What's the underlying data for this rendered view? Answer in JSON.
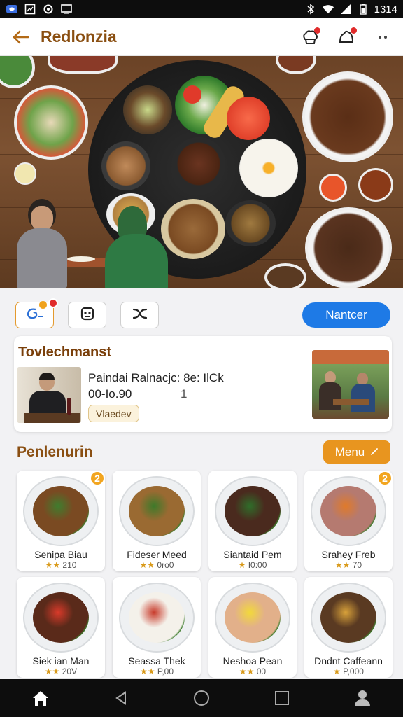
{
  "status_bar": {
    "time": "1314"
  },
  "app_bar": {
    "title": "Redlonzia"
  },
  "filters": {
    "primary_label": "Nantcer"
  },
  "info_card": {
    "title": "Tovlechmanst",
    "line1": "Paindai Ralnacjc: 8e: IlCk",
    "line2": "00-Io.90",
    "number": "1",
    "tag": "Vlaedev"
  },
  "section": {
    "title": "Penlenurin",
    "menu_label": "Menu"
  },
  "foods": [
    {
      "name": "Senipa Biau",
      "rating": "210",
      "stars": "★★",
      "badge": "2",
      "plate": "#7a4a22",
      "accent": "#3f7d2e"
    },
    {
      "name": "Fideser Meed",
      "rating": "0ro0",
      "stars": "★★",
      "badge": "",
      "plate": "#9a6a32",
      "accent": "#3d7a2a"
    },
    {
      "name": "Siantaid Pem",
      "rating": "I0:00",
      "stars": "★",
      "badge": "",
      "plate": "#4a2a1e",
      "accent": "#2f6e2a"
    },
    {
      "name": "Srahey Freb",
      "rating": "70",
      "stars": "★★",
      "badge": "2",
      "plate": "#b57a70",
      "accent": "#e07a2a"
    },
    {
      "name": "Siek ian Man",
      "rating": "20V",
      "stars": "★★",
      "badge": "",
      "plate": "#5a2a1a",
      "accent": "#d93a2a"
    },
    {
      "name": "Seassa Thek",
      "rating": "P,00",
      "stars": "★★",
      "badge": "",
      "plate": "#f4f1ea",
      "accent": "#c83a2a"
    },
    {
      "name": "Neshoa Pean",
      "rating": "00",
      "stars": "★★",
      "badge": "",
      "plate": "#e2b08a",
      "accent": "#f2d93a"
    },
    {
      "name": "Dndnt Caffeann",
      "rating": "P,000",
      "stars": "★",
      "badge": "",
      "plate": "#5a3a22",
      "accent": "#d9a23a"
    }
  ],
  "colors": {
    "accent": "#8a4f12",
    "primary": "#1e7ae6",
    "orange": "#e8951f",
    "badge_red": "#e02b2b"
  }
}
